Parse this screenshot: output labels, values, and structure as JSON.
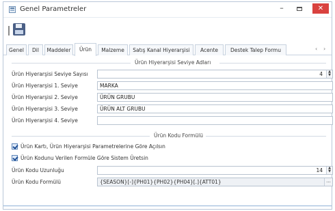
{
  "window": {
    "title": "Genel Parametreler"
  },
  "title_controls": {
    "minimize": "–",
    "close": "✕"
  },
  "toolbar": {
    "save_icon": "save-icon"
  },
  "tabs": [
    {
      "label": "Genel"
    },
    {
      "label": "Dil"
    },
    {
      "label": "Maddeler"
    },
    {
      "label": "Ürün",
      "active": true
    },
    {
      "label": "Malzeme"
    },
    {
      "label": "Satış Kanal Hiyerarşisi"
    },
    {
      "label": "Acente"
    },
    {
      "label": "Destek Talep Formu"
    }
  ],
  "tab_nav": {
    "prev": "‹",
    "next": "›"
  },
  "hierarchy_section": {
    "title": "Ürün Hiyerarşisi Seviye Adları",
    "rows": [
      {
        "label": "Ürün Hiyerarşisi Seviye Sayısı",
        "value": "4"
      },
      {
        "label": "Ürün Hiyerarşisi 1. Seviye",
        "value": "MARKA"
      },
      {
        "label": "Ürün Hiyerarşisi 2. Seviye",
        "value": "ÜRÜN GRUBU"
      },
      {
        "label": "Ürün Hiyerarşisi 3. Seviye",
        "value": "ÜRÜN ALT GRUBU"
      },
      {
        "label": "Ürün Hiyerarşisi 4. Seviye",
        "value": ""
      }
    ]
  },
  "code_section": {
    "title": "Ürün Kodu Formülü",
    "checkbox1": "Ürün Kartı, Ürün Hiyerarşisi Parametrelerine Göre Açılsın",
    "checkbox2": "Ürün Kodunu Verilen Formüle Göre Sistem Üretsin",
    "length_label": "Ürün Kodu Uzunluğu",
    "length_value": "14",
    "formula_label": "Ürün Kodu Formülü",
    "formula_value": "{SEASON}[-]{PH01}{PH02}{PH04}[.]{ATT01}",
    "formula_button": "..."
  },
  "colors": {
    "accent": "#5d85b8",
    "close": "#d9423f",
    "border": "#b8c3d0"
  }
}
